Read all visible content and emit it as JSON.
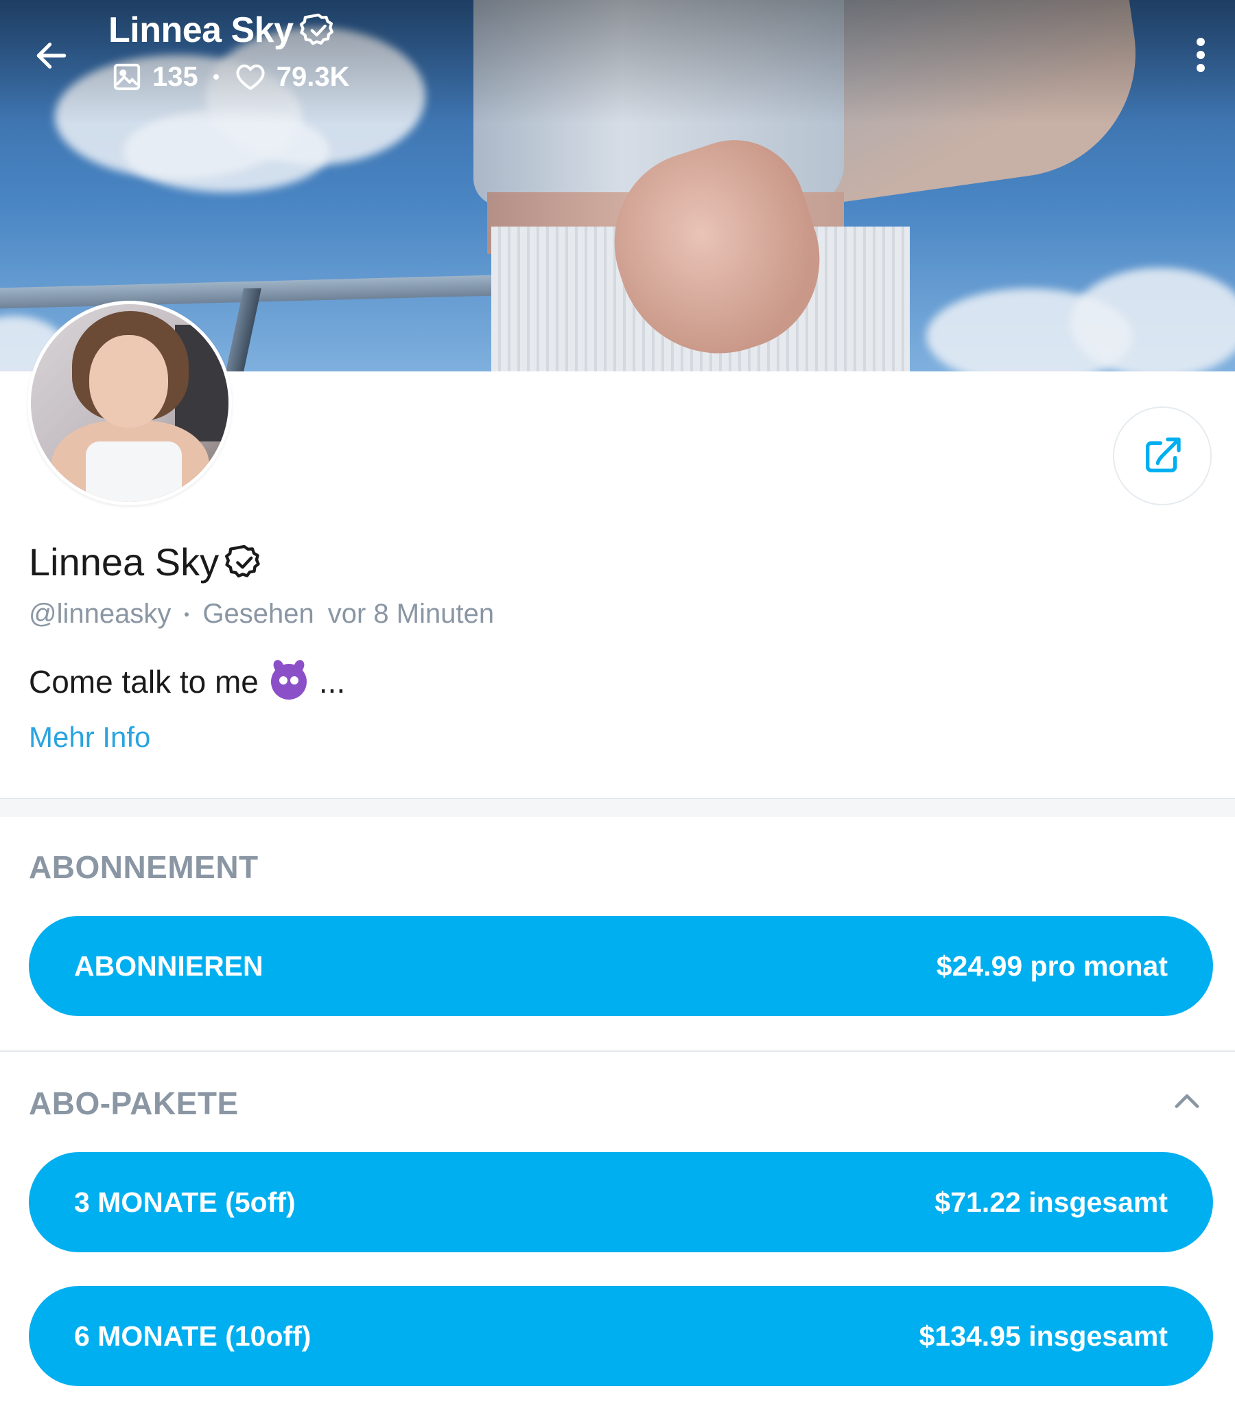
{
  "header": {
    "title": "Linnea Sky",
    "media_count": "135",
    "likes_count": "79.3K"
  },
  "profile": {
    "name": "Linnea Sky",
    "handle": "@linneasky",
    "seen_label": "Gesehen",
    "seen_time": "vor 8 Minuten",
    "bio": "Come talk to me",
    "bio_suffix": "...",
    "more_info": "Mehr Info"
  },
  "subscription": {
    "title": "ABONNEMENT",
    "button_label": "ABONNIEREN",
    "button_price": "$24.99 pro monat"
  },
  "bundles": {
    "title": "ABO-PAKETE",
    "items": [
      {
        "label": "3 MONATE (5off)",
        "price": "$71.22 insgesamt"
      },
      {
        "label": "6 MONATE (10off)",
        "price": "$134.95 insgesamt"
      }
    ]
  },
  "colors": {
    "accent": "#00aff0",
    "link": "#2aa4e0",
    "muted_text": "#8a96a3"
  },
  "icons": [
    "back-arrow-icon",
    "verified-icon",
    "image-icon",
    "heart-icon",
    "more-vertical-icon",
    "share-icon",
    "devil-emoji-icon",
    "chevron-up-icon"
  ]
}
